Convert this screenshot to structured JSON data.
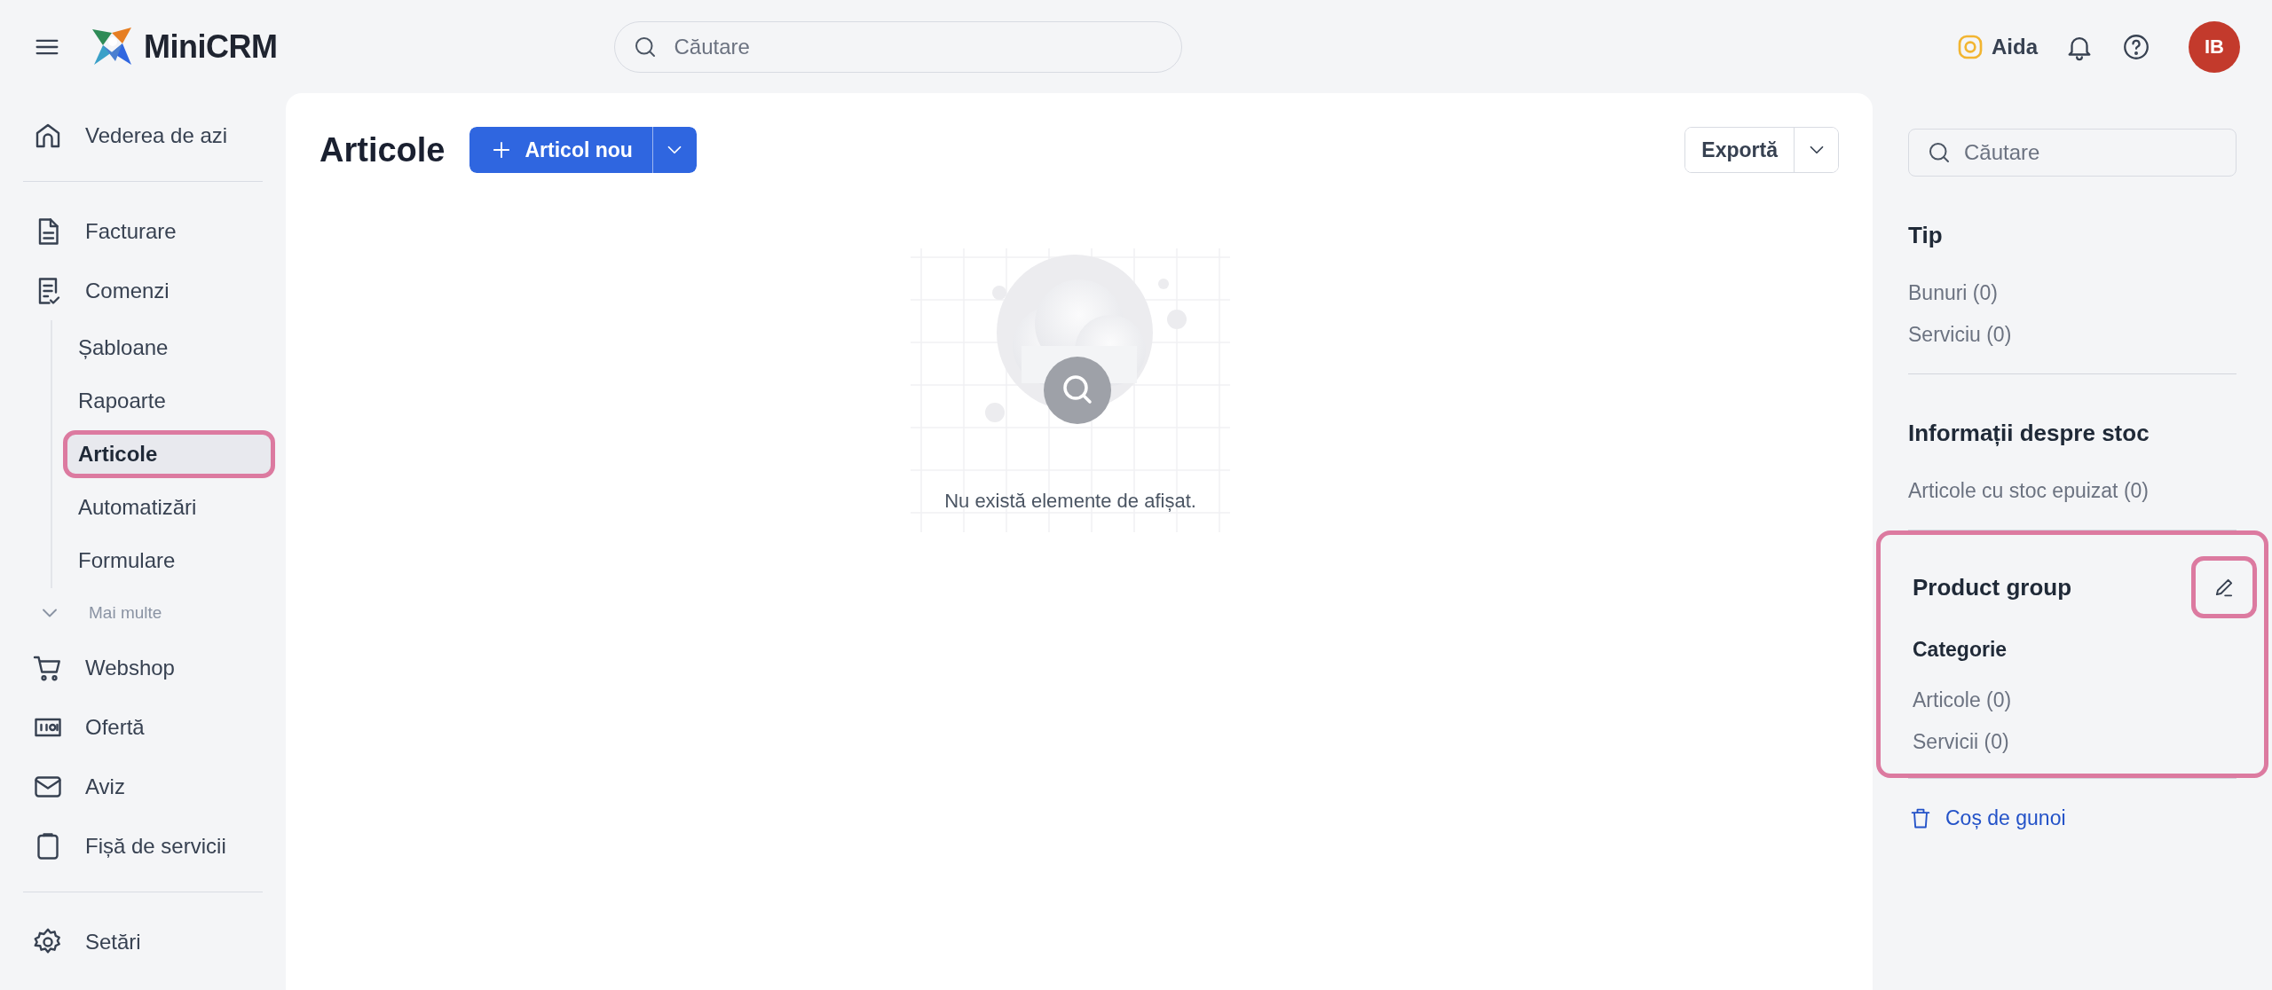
{
  "topbar": {
    "brand": "MiniCRM",
    "search": {
      "placeholder": "Căutare"
    },
    "assistant": "Aida",
    "avatar": "IB"
  },
  "sidebar": {
    "groups": [
      {
        "items": [
          {
            "label": "Vederea de azi",
            "kind": "main",
            "selected": false,
            "highlighted": false
          }
        ]
      },
      {
        "items": [
          {
            "label": "Facturare",
            "kind": "main",
            "selected": false,
            "highlighted": false
          },
          {
            "label": "Comenzi",
            "kind": "main",
            "selected": false,
            "highlighted": false,
            "children": [
              {
                "label": "Șabloane",
                "selected": false,
                "highlighted": false
              },
              {
                "label": "Rapoarte",
                "selected": false,
                "highlighted": false
              },
              {
                "label": "Articole",
                "selected": true,
                "highlighted": true
              },
              {
                "label": "Automatizări",
                "selected": false,
                "highlighted": false
              },
              {
                "label": "Formulare",
                "selected": false,
                "highlighted": false
              }
            ]
          },
          {
            "label": "Mai multe",
            "kind": "more",
            "selected": false,
            "highlighted": false
          },
          {
            "label": "Webshop",
            "kind": "main",
            "selected": false,
            "highlighted": false
          },
          {
            "label": "Ofertă",
            "kind": "main",
            "selected": false,
            "highlighted": false
          },
          {
            "label": "Aviz",
            "kind": "main",
            "selected": false,
            "highlighted": false
          },
          {
            "label": "Fișă de servicii",
            "kind": "main",
            "selected": false,
            "highlighted": false
          }
        ]
      },
      {
        "items": [
          {
            "label": "Setări",
            "kind": "main",
            "selected": false,
            "highlighted": false
          }
        ]
      }
    ]
  },
  "main": {
    "title": "Articole",
    "new_button": "Articol nou",
    "export_button": "Exportă",
    "empty_message": "Nu există elemente de afișat."
  },
  "filters": {
    "search": {
      "placeholder": "Căutare"
    },
    "sections": [
      {
        "title": "Tip",
        "highlighted": false,
        "items": [
          "Bunuri (0)",
          "Serviciu (0)"
        ]
      },
      {
        "title": "Informații despre stoc",
        "highlighted": false,
        "items": [
          "Articole cu stoc epuizat (0)"
        ]
      },
      {
        "title": "Product group",
        "highlighted": true,
        "edit_button": {
          "highlighted": true
        },
        "subtitle": "Categorie",
        "items": [
          "Articole (0)",
          "Servicii (0)"
        ]
      }
    ],
    "trash_link": "Coș de gunoi"
  }
}
